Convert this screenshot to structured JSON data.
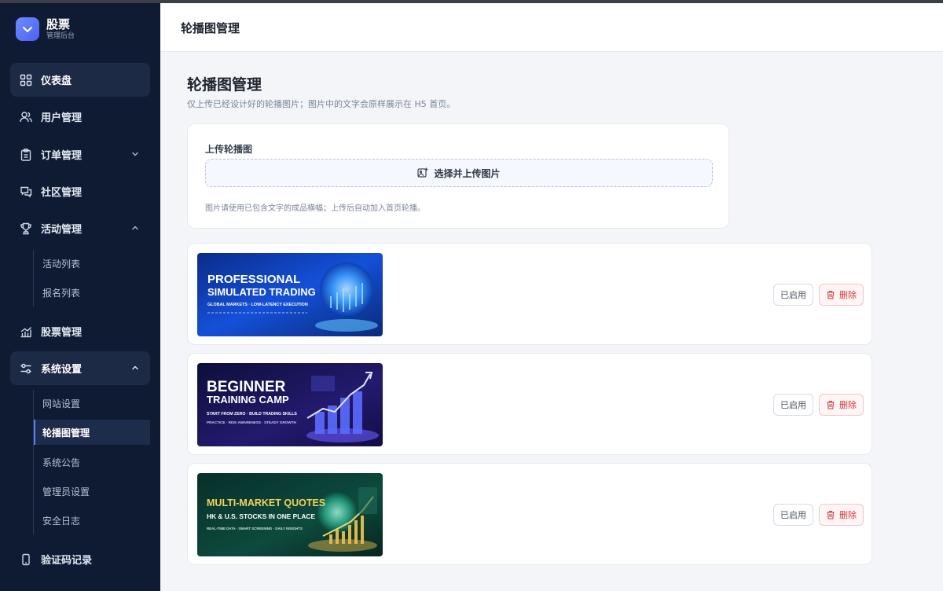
{
  "brand": {
    "title": "股票",
    "subtitle": "管理后台"
  },
  "sidebar": {
    "items": [
      {
        "label": "仪表盘"
      },
      {
        "label": "用户管理"
      },
      {
        "label": "订单管理"
      },
      {
        "label": "社区管理"
      },
      {
        "label": "活动管理"
      },
      {
        "label": "股票管理"
      },
      {
        "label": "系统设置"
      },
      {
        "label": "验证码记录"
      }
    ],
    "activity_sub": [
      "活动列表",
      "报名列表"
    ],
    "settings_sub": [
      "网站设置",
      "轮播图管理",
      "系统公告",
      "管理员设置",
      "安全日志"
    ]
  },
  "header": {
    "title": "轮播图管理"
  },
  "page": {
    "title": "轮播图管理",
    "description": "仅上传已经设计好的轮播图片；图片中的文字会原样展示在 H5 首页。"
  },
  "upload": {
    "label": "上传轮播图",
    "button": "选择并上传图片",
    "hint": "图片请使用已包含文字的成品横幅；上传后自动加入首页轮播。"
  },
  "banners": [
    {
      "line1": "PROFESSIONAL",
      "line2": "SIMULATED TRADING",
      "line3": "GLOBAL MARKETS · LOW-LATENCY EXECUTION",
      "status": "已启用",
      "delete": "删除"
    },
    {
      "line1": "BEGINNER",
      "line2": "TRAINING CAMP",
      "line3": "START FROM ZERO · BUILD TRADING SKILLS",
      "line4": "PRACTICE · RISK AWARENESS · STEADY GROWTH",
      "status": "已启用",
      "delete": "删除"
    },
    {
      "line1": "MULTI-MARKET QUOTES",
      "line2": "HK & U.S. STOCKS IN ONE PLACE",
      "line3": "REAL-TIME DATA · SMART SCREENING · DAILY INSIGHTS",
      "status": "已启用",
      "delete": "删除"
    }
  ],
  "colors": {
    "sidebar_bg": "#0f1b33",
    "accent": "#5b7cff",
    "danger": "#d23c3c"
  }
}
